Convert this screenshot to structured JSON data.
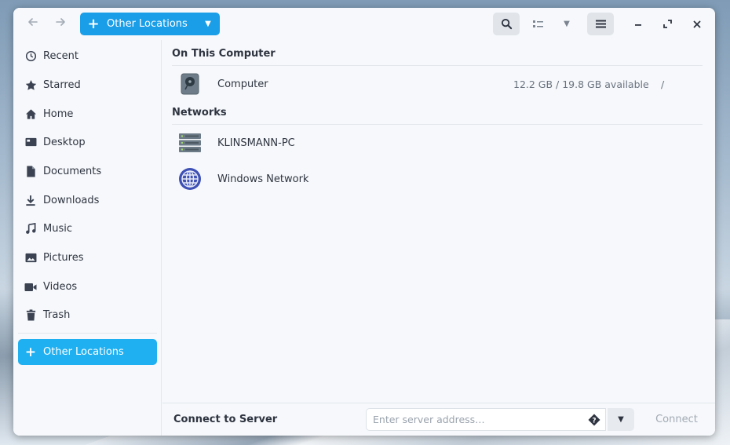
{
  "header": {
    "location_label": "Other Locations",
    "icons": [
      "back-arrow-icon",
      "forward-arrow-icon",
      "plus-icon",
      "chevron-down-icon",
      "search-icon",
      "list-view-icon",
      "hamburger-menu-icon",
      "minimize-icon",
      "maximize-icon",
      "close-icon"
    ]
  },
  "sidebar": {
    "items": [
      {
        "label": "Recent",
        "icon": "clock-icon"
      },
      {
        "label": "Starred",
        "icon": "star-icon"
      },
      {
        "label": "Home",
        "icon": "home-icon"
      },
      {
        "label": "Desktop",
        "icon": "desktop-icon"
      },
      {
        "label": "Documents",
        "icon": "document-icon"
      },
      {
        "label": "Downloads",
        "icon": "download-icon"
      },
      {
        "label": "Music",
        "icon": "music-icon"
      },
      {
        "label": "Pictures",
        "icon": "picture-icon"
      },
      {
        "label": "Videos",
        "icon": "video-icon"
      },
      {
        "label": "Trash",
        "icon": "trash-icon"
      }
    ],
    "other_locations": {
      "label": "Other Locations",
      "icon": "plus-icon"
    }
  },
  "main": {
    "on_this_computer": {
      "title": "On This Computer",
      "items": [
        {
          "name": "Computer",
          "info": "12.2 GB / 19.8 GB available",
          "path": "/",
          "icon": "drive-icon"
        }
      ]
    },
    "networks": {
      "title": "Networks",
      "items": [
        {
          "name": "KLINSMANN-PC",
          "icon": "server-icon"
        },
        {
          "name": "Windows Network",
          "icon": "globe-icon"
        }
      ]
    }
  },
  "actionbar": {
    "label": "Connect to Server",
    "input_placeholder": "Enter server address…",
    "connect_label": "Connect"
  },
  "colors": {
    "accent": "#1a9ee8",
    "sidebar_active": "#1fb0f2",
    "window_bg": "#f6f8fb"
  }
}
